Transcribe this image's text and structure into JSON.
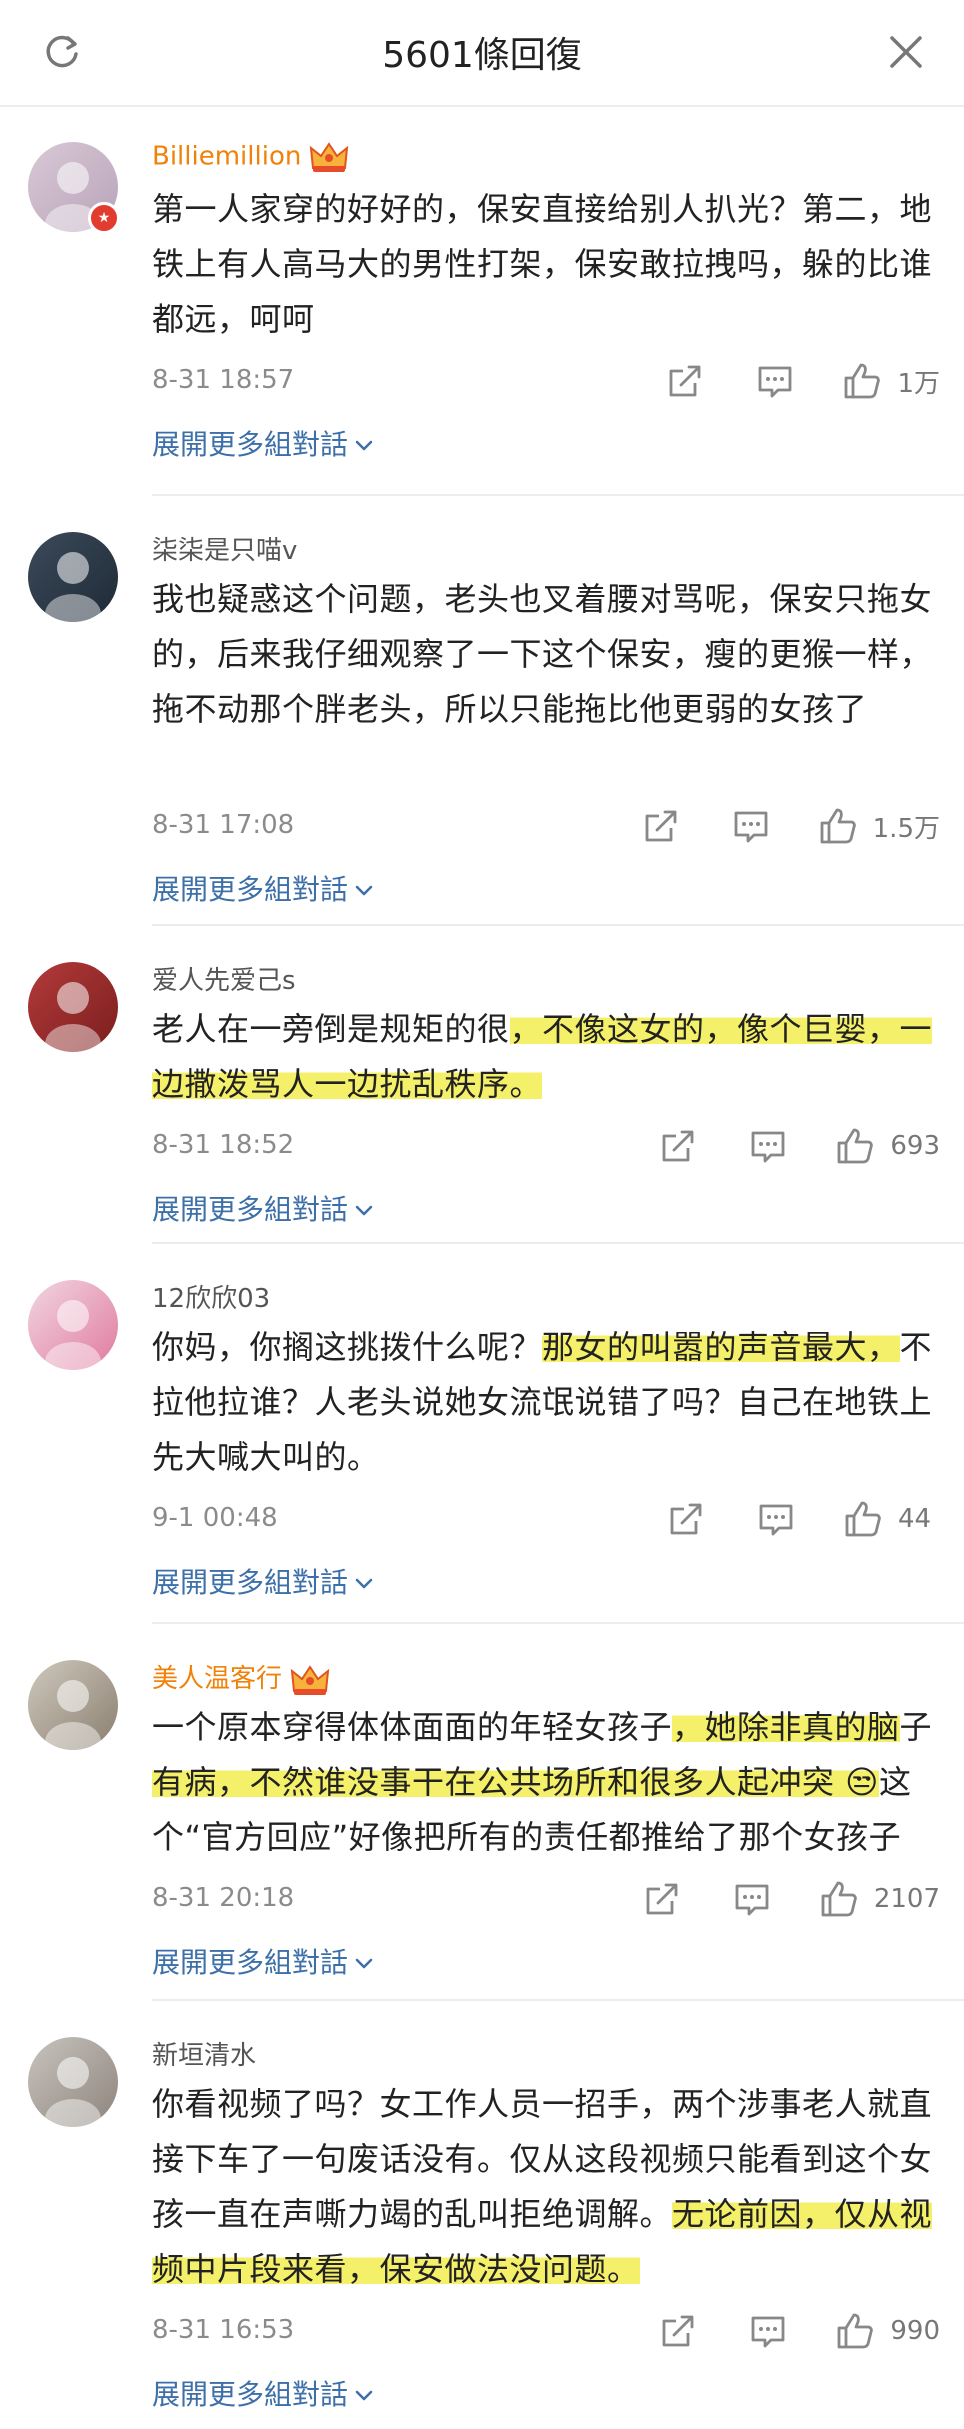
{
  "header": {
    "title": "5601條回復"
  },
  "comments": [
    {
      "username": "Billiemillion",
      "vip": true,
      "text_parts": [
        {
          "t": "第一人家穿的好好的，保安直接给别人扒光？第二，地铁上有人高马大的男性打架，保安敢拉拽吗，躲的比谁都远，呵呵",
          "hl": false
        }
      ],
      "date": "8-31 18:57",
      "likes": "1万",
      "expand": "展開更多組對話"
    },
    {
      "username": "柒柒是只喵v",
      "vip": false,
      "text_parts": [
        {
          "t": "我也疑惑这个问题，老头也叉着腰对骂呢，保安只拖女的，后来我仔细观察了一下这个保安，瘦的更猴一样，拖不动那个胖老头，所以只能拖比他更弱的女孩了",
          "hl": false
        }
      ],
      "date": "8-31 17:08",
      "likes": "1.5万",
      "expand": "展開更多組對話"
    },
    {
      "username": "爱人先爱己s",
      "vip": false,
      "text_parts": [
        {
          "t": "老人在一旁倒是规矩的很",
          "hl": false
        },
        {
          "t": "，不像这女的，像个巨婴，一边撒泼骂人一边扰乱秩序。",
          "hl": true
        }
      ],
      "date": "8-31 18:52",
      "likes": "693",
      "expand": "展開更多組對話"
    },
    {
      "username": "12欣欣03",
      "vip": false,
      "text_parts": [
        {
          "t": "你妈，你搁这挑拨什么呢？",
          "hl": false
        },
        {
          "t": "那女的叫嚣的声音最大，",
          "hl": true
        },
        {
          "t": "不拉他拉谁？人老头说她女流氓说错了吗？自己在地铁上先大喊大叫的。",
          "hl": false
        }
      ],
      "date": "9-1 00:48",
      "likes": "44",
      "expand": "展開更多組對話"
    },
    {
      "username": "美人温客行",
      "vip": true,
      "text_parts": [
        {
          "t": "一个原本穿得体体面面的年轻女孩子",
          "hl": false
        },
        {
          "t": "，她除非真的脑",
          "hl": true
        },
        {
          "t": "子",
          "hl": false
        },
        {
          "t": "有病，不然谁没事干在公共场所和很多人起冲突 😒",
          "hl": true
        },
        {
          "t": "这个“官方回应”好像把所有的责任都推给了那个女孩子",
          "hl": false
        }
      ],
      "date": "8-31 20:18",
      "likes": "2107",
      "expand": "展開更多組對話"
    },
    {
      "username": "新垣清水",
      "vip": false,
      "text_parts": [
        {
          "t": "你看视频了吗？女工作人员一招手，两个涉事老人就直接下车了一句废话没有。仅从这段视频只能看到这个女孩一直在声嘶力竭的乱叫拒绝调解。",
          "hl": false
        },
        {
          "t": "无论前因，仅从视频中片段来看，保安做法没问题。",
          "hl": true
        }
      ],
      "date": "8-31 16:53",
      "likes": "990",
      "expand": "展開更多組對話"
    }
  ]
}
